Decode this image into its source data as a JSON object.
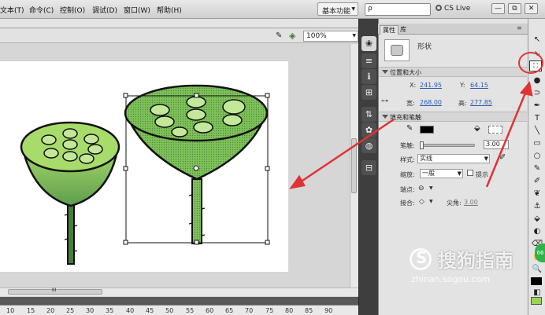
{
  "menu": {
    "items": [
      "文本(T)",
      "命令(C)",
      "控制(O)",
      "调试(D)",
      "窗口(W)",
      "帮助(H)"
    ],
    "workspace": "基本功能",
    "workspace_arrow": "▼",
    "search_placeholder": "",
    "search_icon": "ρ",
    "cslive": "CS Live",
    "window_buttons": [
      "—",
      "⧉",
      "✕"
    ]
  },
  "stage": {
    "zoom": "100%",
    "zoom_arrow": "▼",
    "scroll_grip": "III",
    "timeline_ticks": [
      "10",
      "15",
      "20",
      "25",
      "30",
      "35",
      "40",
      "45",
      "50",
      "55",
      "60",
      "65",
      "70",
      "75",
      "80",
      "85",
      "90"
    ],
    "colors": {
      "fill_light": "#9ad35a",
      "fill_dark": "#5d9e4c",
      "seed": "#c3e89a",
      "stem": "#4a7a3e",
      "selection": "#111111"
    }
  },
  "properties": {
    "tabs": [
      "属性",
      "库"
    ],
    "object_type": "形状",
    "position_section": "位置和大小",
    "x_label": "X:",
    "x_value": "241.95",
    "y_label": "Y:",
    "y_value": "64.15",
    "width_label": "宽:",
    "width_value": "268.00",
    "height_label": "高:",
    "height_value": "277.85",
    "fill_stroke_section": "填充和笔触",
    "stroke_label": "笔触:",
    "stroke_width": "3.00",
    "style_label": "样式:",
    "style_value": "实线",
    "scale_label": "缩放:",
    "scale_value": "一般",
    "hint_label": "提示",
    "cap_label": "端点:",
    "cap_value": "⊖",
    "join_label": "接合:",
    "join_value": "◇",
    "miter_label": "尖角:",
    "miter_value": "3.00",
    "dropdown_arrow": "▼"
  },
  "tools": {
    "icons": [
      "↖",
      "↘",
      "⛶",
      "●",
      "⊃",
      "✒",
      "T",
      "╲",
      "▭",
      "○",
      "✎",
      "✐",
      "❦",
      "⚓",
      "⬙",
      "◐",
      "⌫",
      "✋",
      "🔍",
      "✎",
      "◧"
    ],
    "highlight_color": "#e03333"
  },
  "icon_strip": {
    "icons": [
      "❀",
      "≡",
      "ℹ",
      "⊞",
      "⇅",
      "✿",
      "◍",
      "⊟"
    ]
  },
  "watermark": {
    "brand": "搜狗指南",
    "url": "zhinan.sogou.com",
    "logo_letter": "S",
    "badge": "66"
  }
}
